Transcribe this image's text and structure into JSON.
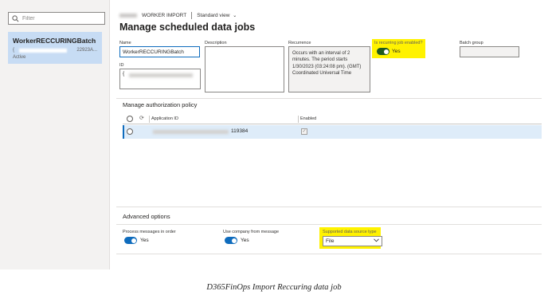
{
  "left_pane": {
    "filter_placeholder": "Filter",
    "card": {
      "title": "WorkerRECCURINGBatch",
      "id_suffix": "22923A...",
      "status": "Active"
    }
  },
  "topbar": {
    "breadcrumb": "WORKER IMPORT",
    "view_label": "Standard view",
    "view_chevron": "⌄"
  },
  "page": {
    "title": "Manage scheduled data jobs"
  },
  "fields": {
    "name_label": "Name",
    "name_value": "WorkerRECCURINGBatch",
    "id_label": "ID",
    "id_value_prefix": "{",
    "description_label": "Description",
    "recurrence_label": "Recurrence",
    "recurrence_value": "Occurs with an interval of 2 minutes. The period starts 1/30/2023 (03:24:08 pm). (GMT) Coordinated Universal Time",
    "recurring_enabled_label": "Is recurring job enabled?",
    "recurring_enabled_value": "Yes",
    "batch_group_label": "Batch group"
  },
  "auth_policy": {
    "title": "Manage authorization policy",
    "columns": {
      "application_id": "Application ID",
      "enabled": "Enabled"
    },
    "rows": [
      {
        "application_id_suffix": "119384",
        "enabled": true
      }
    ]
  },
  "advanced": {
    "title": "Advanced options",
    "process_in_order_label": "Process messages in order",
    "process_in_order_value": "Yes",
    "use_company_label": "Use company from message",
    "use_company_value": "Yes",
    "data_source_label": "Supported data source type",
    "data_source_value": "File"
  },
  "caption": "D365FinOps Import Reccuring data job",
  "colors": {
    "accent": "#0f6cbd",
    "highlight": "#fff200",
    "selected_card": "#c7dcf4"
  }
}
